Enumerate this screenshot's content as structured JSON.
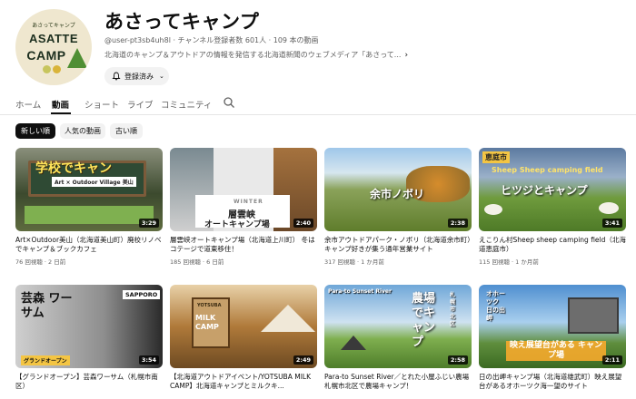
{
  "channel": {
    "avatar_tagline": "あさってキャンプ",
    "avatar_brand_line1": "ASATTE",
    "avatar_brand_line2": "CAMP",
    "name": "あさってキャンプ",
    "meta": "@user-pt3sb4uh8l · チャンネル登録者数 601人 · 109 本の動画",
    "description": "北海道のキャンプ＆アウトドアの情報を発信する北海道新聞のウェブメディア「あさって...",
    "subscribe_label": "登録済み"
  },
  "tabs": [
    {
      "label": "ホーム"
    },
    {
      "label": "動画"
    },
    {
      "label": "ショート"
    },
    {
      "label": "ライブ"
    },
    {
      "label": "コミュニティ"
    }
  ],
  "filters": [
    {
      "label": "新しい順"
    },
    {
      "label": "人気の動画"
    },
    {
      "label": "古い順"
    }
  ],
  "videos": [
    {
      "title": "Art×Outdoor美山（北海道美山町）廃校リノベでキャンプ＆ブックカフェ",
      "stats": "76 回視聴 · 2 日前",
      "duration": "3:29",
      "thumb_text": "学校でキャン",
      "thumb_sub": "Art × Outdoor Village 美山"
    },
    {
      "title": "層雲峡オートキャンプ場（北海道上川町） 冬はコテージで道東移住！",
      "stats": "185 回視聴 · 6 日前",
      "duration": "2:40",
      "thumb_text": "層雲峡",
      "thumb_sub": "オートキャンプ場",
      "thumb_top": "WINTER"
    },
    {
      "title": "余市アウトドアパーク・ノボリ（北海道余市町）キャンプ好きが集う通年営業サイト",
      "stats": "317 回視聴 · 1 か月前",
      "duration": "2:38",
      "thumb_text": "余市ノボリ"
    },
    {
      "title": "えこりん村Sheep sheep camping field（北海道恵庭市）",
      "stats": "115 回視聴 · 1 か月前",
      "duration": "3:41",
      "thumb_text": "ヒツジとキャンプ",
      "thumb_sub": "Sheep Sheep camping field",
      "thumb_top": "恵庭市"
    },
    {
      "title": "【グランドオープン】芸森ワーサム（札幌市南区）",
      "stats": "",
      "duration": "3:54",
      "thumb_text": "芸森 ワーサム",
      "thumb_top": "SAPPORO",
      "thumb_sub": "グランドオープン"
    },
    {
      "title": "【北海道アウトドアイベント/YOTSUBA MILK CAMP】北海道キャンプとミルクキ...",
      "stats": "",
      "duration": "2:49",
      "thumb_text": "MILK CAMP",
      "thumb_top": "YOTSUBA"
    },
    {
      "title": "Para-to Sunset River／とれた小屋ふじい農場　札幌市北区で農場キャンプ！",
      "stats": "",
      "duration": "2:58",
      "thumb_text": "農場でキャンプ",
      "thumb_top": "Para-to Sunset River",
      "thumb_sub": "札幌市北区"
    },
    {
      "title": "日の出岬キャンプ場（北海道雄武町）映え展望台があるオホーツク海一望のサイト",
      "stats": "",
      "duration": "2:11",
      "thumb_text": "映え展望台がある キャンプ場",
      "thumb_top": "オホーツク 日の出岬"
    }
  ]
}
